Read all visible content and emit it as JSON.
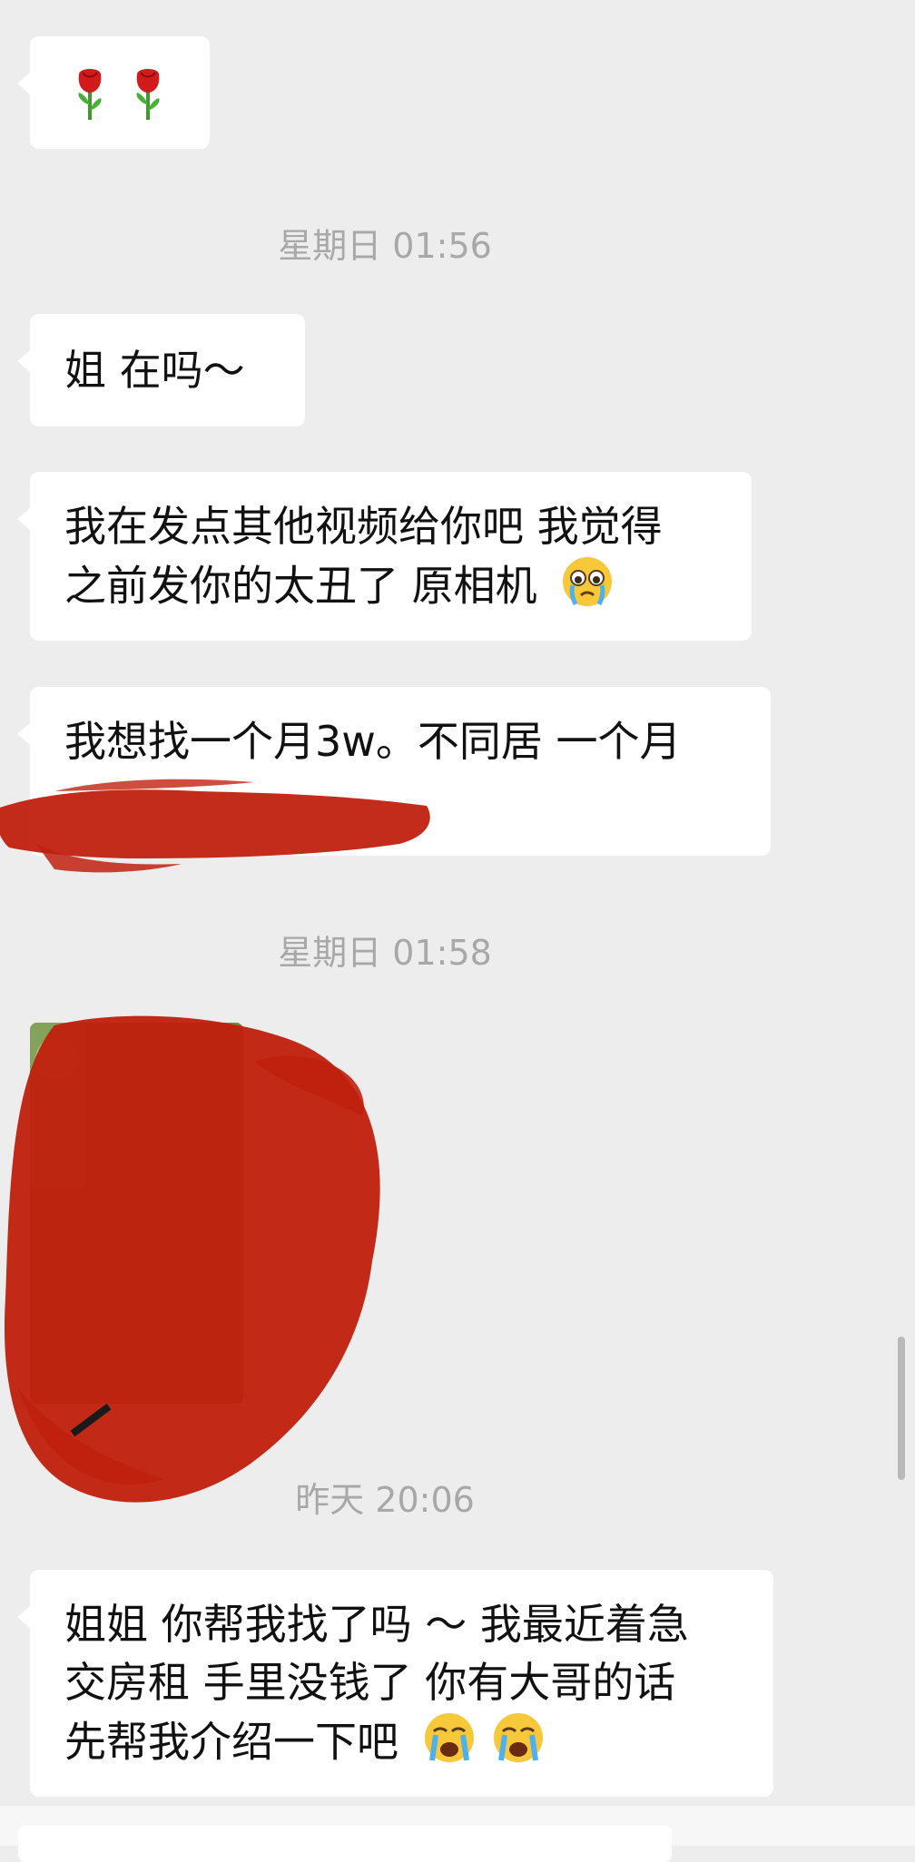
{
  "chat": {
    "timestamps": [
      "星期日 01:56",
      "星期日 01:58",
      "昨天 20:06"
    ],
    "messages": {
      "m1_emoji": [
        "rose-emoji",
        "rose-emoji"
      ],
      "m2": "姐 在吗～",
      "m3_line1": "我在发点其他视频给你吧 我觉得",
      "m3_line2": "之前发你的太丑了 原相机",
      "m4_line1": "我想找一个月3w。不同居 一个月",
      "m5_line1": "姐姐 你帮我找了吗 ～ 我最近着急",
      "m5_line2": "交房租 手里没钱了 你有大哥的话",
      "m5_line3": "先帮我介绍一下吧"
    },
    "icons": {
      "crying_face": "crying-face-emoji",
      "loudly_crying": "loudly-crying-emoji",
      "rose": "rose-emoji"
    },
    "redaction_color": "#c0200e"
  }
}
